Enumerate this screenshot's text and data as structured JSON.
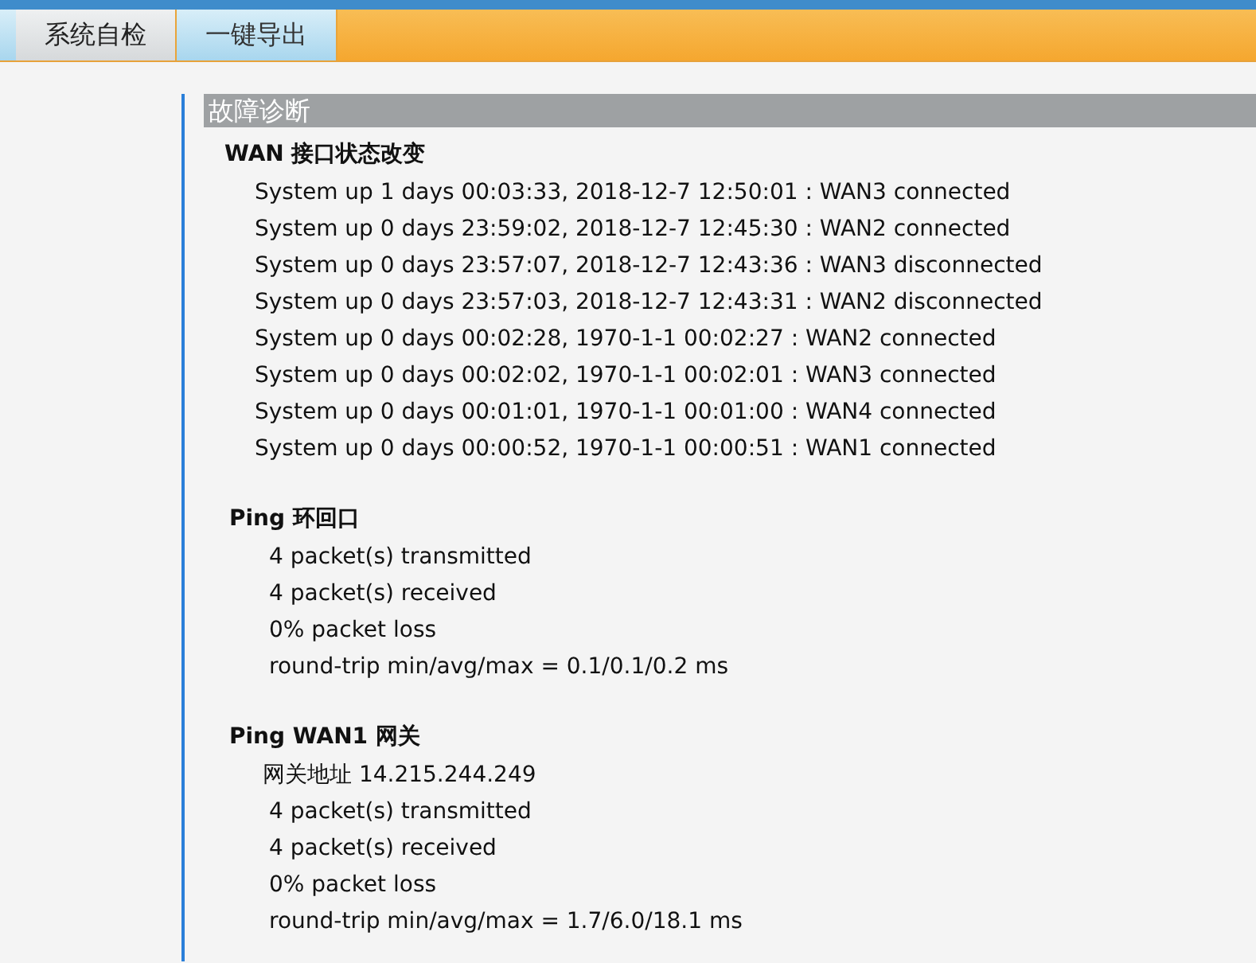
{
  "tabs": [
    {
      "label": "系统自检",
      "selected": true
    },
    {
      "label": "一键导出",
      "selected": false
    }
  ],
  "panel": {
    "title": "故障诊断",
    "sections": [
      {
        "title": "WAN 接口状态改变",
        "kind": "log",
        "lines": [
          {
            "kind": "stat",
            "text": "System up 1 days 00:03:33, 2018-12-7 12:50:01 : WAN3 connected"
          },
          {
            "kind": "stat",
            "text": "System up 0 days 23:59:02, 2018-12-7 12:45:30 : WAN2 connected"
          },
          {
            "kind": "stat",
            "text": "System up 0 days 23:57:07, 2018-12-7 12:43:36 : WAN3 disconnected"
          },
          {
            "kind": "stat",
            "text": "System up 0 days 23:57:03, 2018-12-7 12:43:31 : WAN2 disconnected"
          },
          {
            "kind": "stat",
            "text": "System up 0 days 00:02:28, 1970-1-1 00:02:27 : WAN2 connected"
          },
          {
            "kind": "stat",
            "text": "System up 0 days 00:02:02, 1970-1-1 00:02:01 : WAN3 connected"
          },
          {
            "kind": "stat",
            "text": "System up 0 days 00:01:01, 1970-1-1 00:01:00 : WAN4 connected"
          },
          {
            "kind": "stat",
            "text": "System up 0 days 00:00:52, 1970-1-1 00:00:51 : WAN1 connected"
          }
        ]
      },
      {
        "title": "Ping 环回口",
        "kind": "ping",
        "lines": [
          {
            "kind": "stat",
            "text": "4 packet(s) transmitted"
          },
          {
            "kind": "stat",
            "text": "4 packet(s) received"
          },
          {
            "kind": "stat",
            "text": "0% packet loss"
          },
          {
            "kind": "stat",
            "text": "round-trip min/avg/max = 0.1/0.1/0.2 ms"
          }
        ]
      },
      {
        "title": "Ping WAN1 网关",
        "kind": "ping",
        "lines": [
          {
            "kind": "gateway",
            "text": "网关地址 14.215.244.249"
          },
          {
            "kind": "stat",
            "text": "4 packet(s) transmitted"
          },
          {
            "kind": "stat",
            "text": "4 packet(s) received"
          },
          {
            "kind": "stat",
            "text": "0% packet loss"
          },
          {
            "kind": "stat",
            "text": "round-trip min/avg/max = 1.7/6.0/18.1 ms"
          }
        ]
      }
    ]
  }
}
